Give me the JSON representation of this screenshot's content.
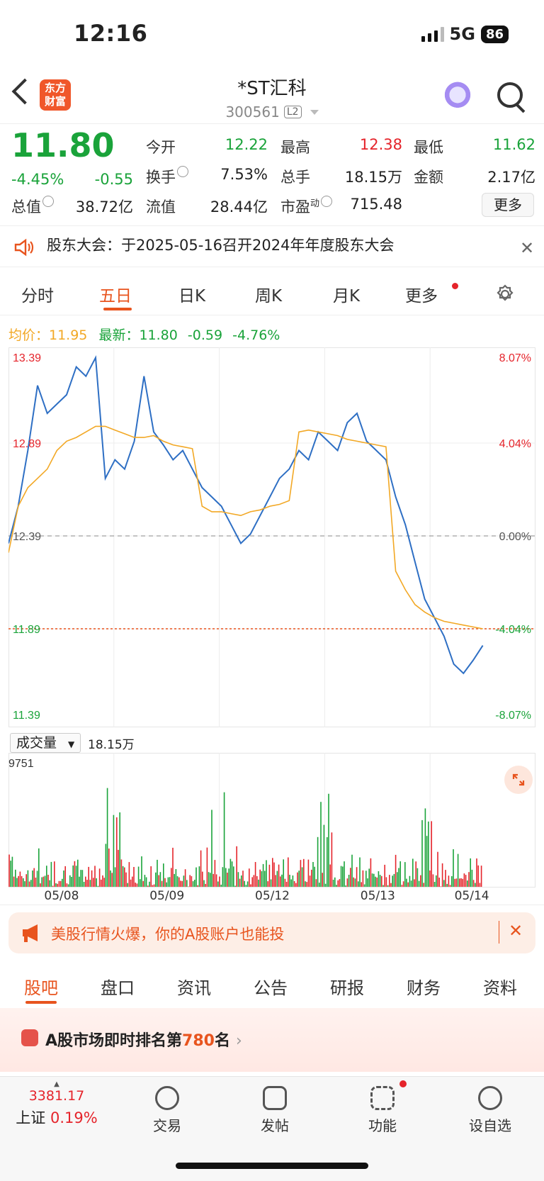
{
  "status_bar": {
    "time": "12:16",
    "network": "5G",
    "battery": "86"
  },
  "header": {
    "logo_text_1": "东方",
    "logo_text_2": "财富",
    "stock_name": "*ST汇科",
    "stock_code": "300561",
    "level_badge": "L2"
  },
  "quote": {
    "price": "11.80",
    "change_pct": "-4.45%",
    "change": "-0.55",
    "open_label": "今开",
    "open": "12.22",
    "high_label": "最高",
    "high": "12.38",
    "low_label": "最低",
    "low": "11.62",
    "turnover_label": "换手",
    "turnover": "7.53%",
    "volume_label": "总手",
    "volume": "18.15万",
    "amount_label": "金额",
    "amount": "2.17亿",
    "mktcap_label": "总值",
    "mktcap": "38.72亿",
    "float_label": "流值",
    "float": "28.44亿",
    "pe_label": "市盈",
    "pe_sup": "动",
    "pe": "715.48",
    "more_label": "更多"
  },
  "notice": {
    "text": "股东大会：于2025-05-16召开2024年年度股东大会"
  },
  "tabs": [
    "分时",
    "五日",
    "日K",
    "周K",
    "月K",
    "更多"
  ],
  "active_tab": "五日",
  "chart_legend": {
    "avg_label": "均价：11.95",
    "latest_label": "最新：11.80",
    "latest_change": "-0.59",
    "latest_pct": "-4.76%"
  },
  "chart_data": {
    "type": "line",
    "x": [
      "05/08",
      "05/09",
      "05/12",
      "05/13",
      "05/14"
    ],
    "y_left_ticks": [
      "13.39",
      "12.89",
      "12.39",
      "11.89",
      "11.39"
    ],
    "y_right_ticks": [
      "8.07%",
      "4.04%",
      "0.00%",
      "-4.04%",
      "-8.07%"
    ],
    "ylim": [
      11.39,
      13.39
    ],
    "prev_close": 12.39,
    "current_line": 11.89,
    "series": [
      {
        "name": "最新",
        "color": "#2e6fc4",
        "values": [
          12.35,
          12.55,
          12.85,
          13.2,
          13.05,
          13.1,
          13.15,
          13.3,
          13.25,
          13.35,
          12.7,
          12.8,
          12.75,
          12.9,
          13.25,
          12.95,
          12.88,
          12.8,
          12.85,
          12.75,
          12.65,
          12.6,
          12.55,
          12.45,
          12.35,
          12.4,
          12.5,
          12.6,
          12.7,
          12.75,
          12.85,
          12.8,
          12.95,
          12.9,
          12.85,
          13.0,
          13.05,
          12.9,
          12.85,
          12.8,
          12.6,
          12.45,
          12.25,
          12.05,
          11.95,
          11.85,
          11.7,
          11.65,
          11.72,
          11.8
        ]
      },
      {
        "name": "均价",
        "color": "#f2a825",
        "values": [
          12.3,
          12.55,
          12.65,
          12.7,
          12.75,
          12.85,
          12.9,
          12.92,
          12.95,
          12.98,
          12.98,
          12.96,
          12.94,
          12.92,
          12.92,
          12.93,
          12.9,
          12.88,
          12.87,
          12.86,
          12.55,
          12.52,
          12.52,
          12.51,
          12.5,
          12.52,
          12.53,
          12.55,
          12.56,
          12.58,
          12.95,
          12.96,
          12.95,
          12.94,
          12.93,
          12.91,
          12.9,
          12.89,
          12.88,
          12.87,
          12.2,
          12.1,
          12.02,
          11.98,
          11.95,
          11.93,
          11.92,
          11.91,
          11.9,
          11.89
        ]
      }
    ],
    "volume": {
      "label": "成交量",
      "total": "18.15万",
      "max_label": "9751"
    }
  },
  "promo": {
    "text": "美股行情火爆，你的A股账户也能投"
  },
  "bottom_tabs": [
    "股吧",
    "盘口",
    "资讯",
    "公告",
    "研报",
    "财务",
    "资料"
  ],
  "ranking": {
    "prefix": "A股市场即时排名第",
    "rank": "780",
    "suffix": "名"
  },
  "tabbar": {
    "index_value": "3381.17",
    "index_name": "上证",
    "index_pct": "0.19%",
    "items": [
      "交易",
      "发帖",
      "功能",
      "设自选"
    ]
  }
}
